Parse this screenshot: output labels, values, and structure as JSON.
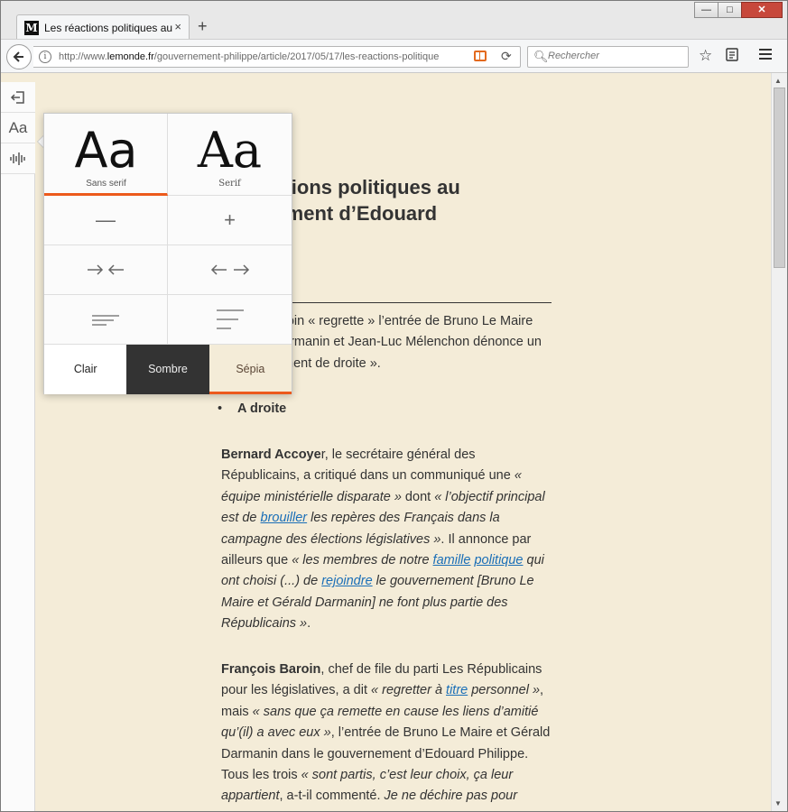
{
  "browser": {
    "tab_title": "Les réactions politiques au go",
    "tab_close": "×",
    "new_tab": "+",
    "url_prefix": "http://www.",
    "url_domain": "lemonde.fr",
    "url_rest": "/gouvernement-philippe/article/2017/05/17/les-reactions-politique",
    "search_placeholder": "Rechercher",
    "win_minimize": "—",
    "win_maximize": "□",
    "win_close": "✕"
  },
  "reader_popup": {
    "fonts": [
      {
        "sample": "Aa",
        "label": "Sans serif",
        "selected": true
      },
      {
        "sample": "Aa",
        "label": "Serif",
        "selected": false
      }
    ],
    "size_decrease": "—",
    "size_increase": "+",
    "width_narrow": "→←",
    "width_wide": "←→",
    "themes": [
      "Clair",
      "Sombre",
      "Sépia"
    ],
    "selected_theme": "Sépia"
  },
  "article": {
    "headline": "actions politiques au\nnement d’Edouard\ne",
    "lead": "roin « regrette » l’entrée de Bruno Le Maire\narmanin et Jean-Luc Mélenchon dénonce un\nment de droite ».",
    "bullet": "A droite",
    "para1": {
      "name": "Bernard Accoye",
      "text_a": "r, le secrétaire général des Républicains, a critiqué dans un communiqué une ",
      "quote1": "« équipe ministérielle disparate »",
      "text_b": " dont ",
      "quote2a": "« l’objectif principal est de ",
      "link1": "brouiller",
      "quote2b": " les repères des Français dans la campagne des élections législatives »",
      "text_c": ". Il annonce par ailleurs que ",
      "quote3a": "« les membres de notre ",
      "link2": "famille",
      "link3": "politique",
      "quote3b": " qui ont choisi (...) de ",
      "link4": "rejoindre",
      "quote3c": " le gouvernement [Bruno Le Maire et Gérald Darmanin] ne font plus partie des Républicains »",
      "text_d": "."
    },
    "para2": {
      "name": "François Baroin",
      "text_a": ", chef de file du parti Les Républicains pour les législatives, a dit ",
      "quote1a": "« regretter à ",
      "link1": "titre",
      "quote1b": " personnel »",
      "text_b": ", mais ",
      "quote2": "« sans que ça remette en cause les liens d’amitié qu’(il) a avec eux »",
      "text_c": ", l’entrée de Bruno Le Maire et Gérald Darmanin dans le gouvernement d’Edouard Philippe. Tous les trois ",
      "quote3": "« sont partis, c’est leur choix, ça leur appartient",
      "text_d": ", a-t-il commenté. ",
      "quote4": "Je ne déchire pas pour"
    }
  },
  "colors": {
    "accent": "#ec5a1c",
    "sepia_bg": "#f4ecd8",
    "link": "#1b6fb7"
  }
}
